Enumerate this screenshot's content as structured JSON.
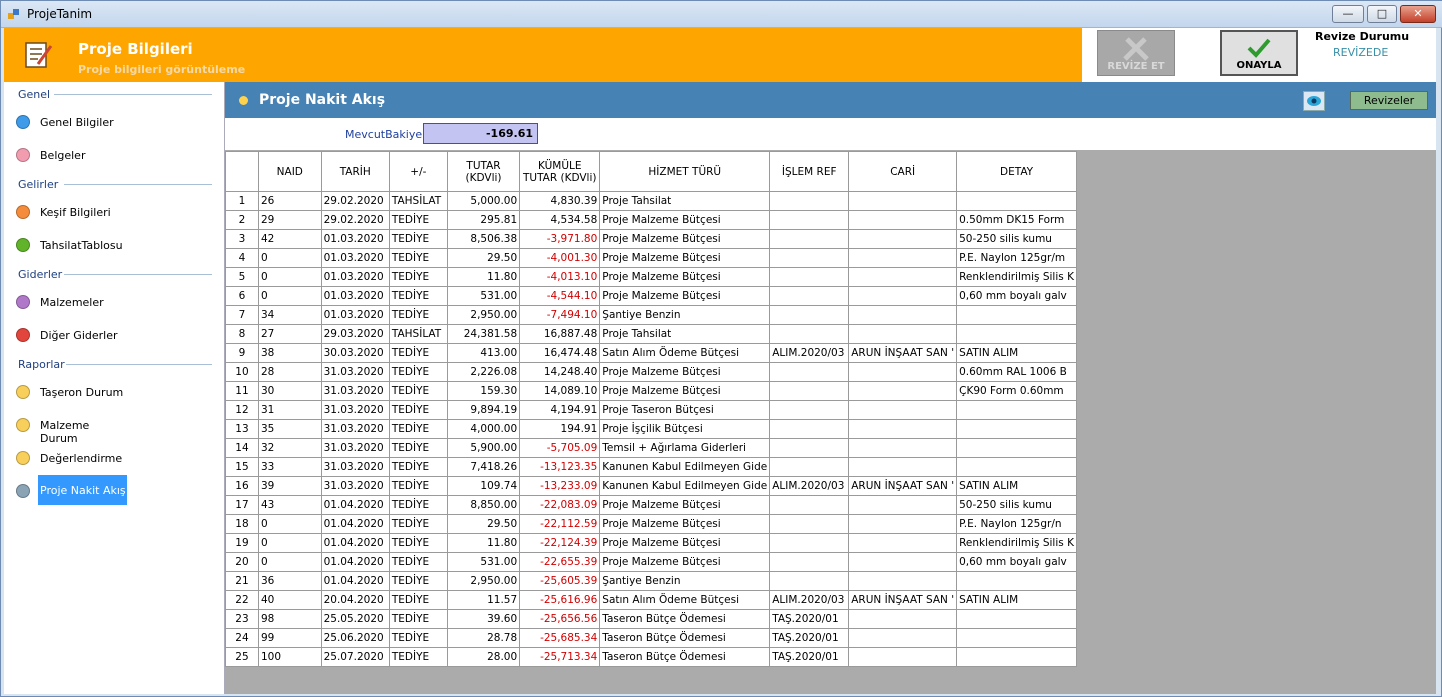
{
  "window": {
    "title": "ProjeTanim",
    "minimize": "—",
    "maximize": "□",
    "close": "✕"
  },
  "header": {
    "title": "Proje Bilgileri",
    "subtitle": "Proje bilgileri görüntüleme"
  },
  "actions": {
    "revize_label": "REVİZE ET",
    "onayla_label": "ONAYLA",
    "revize_durumu_label": "Revize Durumu",
    "revize_durumu_value": "REVİZEDE"
  },
  "sidebar": {
    "sections": [
      {
        "title": "Genel",
        "items": [
          "Genel Bilgiler",
          "Belgeler"
        ]
      },
      {
        "title": "Gelirler",
        "items": [
          "Keşif Bilgileri",
          "TahsilatTablosu"
        ]
      },
      {
        "title": "Giderler",
        "items": [
          "Malzemeler",
          "Diğer Giderler"
        ]
      },
      {
        "title": "Raporlar",
        "items": [
          "Taşeron Durum",
          "Malzeme Durum",
          "Değerlendirme",
          "Proje Nakit Akış"
        ]
      }
    ],
    "selected": "Proje Nakit Akış",
    "dot_colors": [
      "#3d9be9",
      "#f29cb0",
      "#f58c3b",
      "#61b329",
      "#b078c9",
      "#e2453c",
      "#f7cf5a",
      "#f7cf5a",
      "#f7cf5a",
      "#8aa3b5"
    ]
  },
  "main": {
    "title": "Proje Nakit Akış",
    "revizeler_label": "Revizeler",
    "mevcut_bakiye_label": "MevcutBakiye",
    "mevcut_bakiye_value": "-169.61"
  },
  "table": {
    "columns": [
      "NAID",
      "TARİH",
      "+/-",
      "TUTAR (KDVli)",
      "KÜMÜLE TUTAR (KDVli)",
      "HİZMET TÜRÜ",
      "İŞLEM REF",
      "CARİ",
      "DETAY"
    ],
    "rows": [
      [
        "1",
        "26",
        "29.02.2020",
        "TAHSİLAT",
        "5,000.00",
        "4,830.39",
        "Proje Tahsilat",
        "",
        "",
        ""
      ],
      [
        "2",
        "29",
        "29.02.2020",
        "TEDİYE",
        "295.81",
        "4,534.58",
        "Proje Malzeme Bütçesi",
        "",
        "",
        "0.50mm DK15 Form"
      ],
      [
        "3",
        "42",
        "01.03.2020",
        "TEDİYE",
        "8,506.38",
        "-3,971.80",
        "Proje Malzeme Bütçesi",
        "",
        "",
        "50-250 silis kumu"
      ],
      [
        "4",
        "0",
        "01.03.2020",
        "TEDİYE",
        "29.50",
        "-4,001.30",
        "Proje Malzeme Bütçesi",
        "",
        "",
        "P.E. Naylon 125gr/m"
      ],
      [
        "5",
        "0",
        "01.03.2020",
        "TEDİYE",
        "11.80",
        "-4,013.10",
        "Proje Malzeme Bütçesi",
        "",
        "",
        "Renklendirilmiş Silis K"
      ],
      [
        "6",
        "0",
        "01.03.2020",
        "TEDİYE",
        "531.00",
        "-4,544.10",
        "Proje Malzeme Bütçesi",
        "",
        "",
        "0,60 mm boyalı galv"
      ],
      [
        "7",
        "34",
        "01.03.2020",
        "TEDİYE",
        "2,950.00",
        "-7,494.10",
        "Şantiye Benzin",
        "",
        "",
        ""
      ],
      [
        "8",
        "27",
        "29.03.2020",
        "TAHSİLAT",
        "24,381.58",
        "16,887.48",
        "Proje Tahsilat",
        "",
        "",
        ""
      ],
      [
        "9",
        "38",
        "30.03.2020",
        "TEDİYE",
        "413.00",
        "16,474.48",
        "Satın Alım Ödeme Bütçesi",
        "ALIM.2020/03",
        "ARUN İNŞAAT SAN '",
        "SATIN ALIM"
      ],
      [
        "10",
        "28",
        "31.03.2020",
        "TEDİYE",
        "2,226.08",
        "14,248.40",
        "Proje Malzeme Bütçesi",
        "",
        "",
        "0.60mm RAL 1006 B"
      ],
      [
        "11",
        "30",
        "31.03.2020",
        "TEDİYE",
        "159.30",
        "14,089.10",
        "Proje Malzeme Bütçesi",
        "",
        "",
        "ÇK90 Form 0.60mm"
      ],
      [
        "12",
        "31",
        "31.03.2020",
        "TEDİYE",
        "9,894.19",
        "4,194.91",
        "Proje Taseron Bütçesi",
        "",
        "",
        ""
      ],
      [
        "13",
        "35",
        "31.03.2020",
        "TEDİYE",
        "4,000.00",
        "194.91",
        "Proje İşçilik Bütçesi",
        "",
        "",
        ""
      ],
      [
        "14",
        "32",
        "31.03.2020",
        "TEDİYE",
        "5,900.00",
        "-5,705.09",
        "Temsil + Ağırlama Giderleri",
        "",
        "",
        ""
      ],
      [
        "15",
        "33",
        "31.03.2020",
        "TEDİYE",
        "7,418.26",
        "-13,123.35",
        "Kanunen Kabul Edilmeyen Gide",
        "",
        "",
        ""
      ],
      [
        "16",
        "39",
        "31.03.2020",
        "TEDİYE",
        "109.74",
        "-13,233.09",
        "Kanunen Kabul Edilmeyen Gide",
        "ALIM.2020/03",
        "ARUN İNŞAAT SAN '",
        "SATIN ALIM"
      ],
      [
        "17",
        "43",
        "01.04.2020",
        "TEDİYE",
        "8,850.00",
        "-22,083.09",
        "Proje Malzeme Bütçesi",
        "",
        "",
        "50-250 silis kumu"
      ],
      [
        "18",
        "0",
        "01.04.2020",
        "TEDİYE",
        "29.50",
        "-22,112.59",
        "Proje Malzeme Bütçesi",
        "",
        "",
        "P.E. Naylon 125gr/n"
      ],
      [
        "19",
        "0",
        "01.04.2020",
        "TEDİYE",
        "11.80",
        "-22,124.39",
        "Proje Malzeme Bütçesi",
        "",
        "",
        "Renklendirilmiş Silis K"
      ],
      [
        "20",
        "0",
        "01.04.2020",
        "TEDİYE",
        "531.00",
        "-22,655.39",
        "Proje Malzeme Bütçesi",
        "",
        "",
        "0,60 mm boyalı galv"
      ],
      [
        "21",
        "36",
        "01.04.2020",
        "TEDİYE",
        "2,950.00",
        "-25,605.39",
        "Şantiye Benzin",
        "",
        "",
        ""
      ],
      [
        "22",
        "40",
        "20.04.2020",
        "TEDİYE",
        "11.57",
        "-25,616.96",
        "Satın Alım Ödeme Bütçesi",
        "ALIM.2020/03",
        "ARUN İNŞAAT SAN '",
        "SATIN ALIM"
      ],
      [
        "23",
        "98",
        "25.05.2020",
        "TEDİYE",
        "39.60",
        "-25,656.56",
        "Taseron Bütçe Ödemesi",
        "TAŞ.2020/01",
        "",
        ""
      ],
      [
        "24",
        "99",
        "25.06.2020",
        "TEDİYE",
        "28.78",
        "-25,685.34",
        "Taseron Bütçe Ödemesi",
        "TAŞ.2020/01",
        "",
        ""
      ],
      [
        "25",
        "100",
        "25.07.2020",
        "TEDİYE",
        "28.00",
        "-25,713.34",
        "Taseron Bütçe Ödemesi",
        "TAŞ.2020/01",
        "",
        ""
      ]
    ]
  }
}
